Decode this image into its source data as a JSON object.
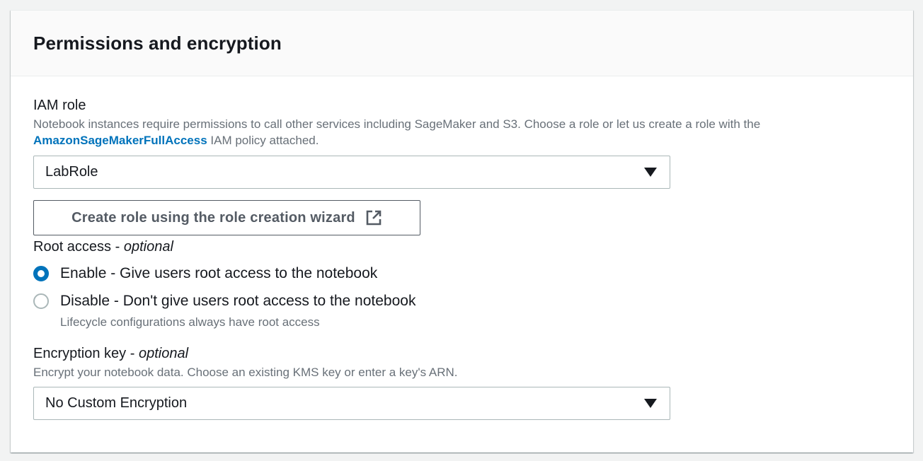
{
  "section": {
    "title": "Permissions and encryption"
  },
  "iam_role": {
    "label": "IAM role",
    "description_part1": "Notebook instances require permissions to call other services including SageMaker and S3. Choose a role or let us create a role with the",
    "policy_link": "AmazonSageMakerFullAccess",
    "description_part2": " IAM policy attached.",
    "selected": "LabRole",
    "create_button": "Create role using the role creation wizard"
  },
  "root_access": {
    "label": "Root access - ",
    "optional": "optional",
    "options": [
      {
        "label": "Enable - Give users root access to the notebook",
        "checked": true
      },
      {
        "label": "Disable - Don't give users root access to the notebook",
        "checked": false
      }
    ],
    "disable_note": "Lifecycle configurations always have root access"
  },
  "encryption": {
    "label": "Encryption key - ",
    "optional": "optional",
    "description": "Encrypt your notebook data. Choose an existing KMS key or enter a key's ARN.",
    "selected": "No Custom Encryption"
  },
  "colors": {
    "link": "#0073bb",
    "radio_selected": "#0073bb",
    "secondary_text": "#687078"
  },
  "icons": {
    "select_caret": "caret-down-icon",
    "external_link": "external-link-icon"
  }
}
